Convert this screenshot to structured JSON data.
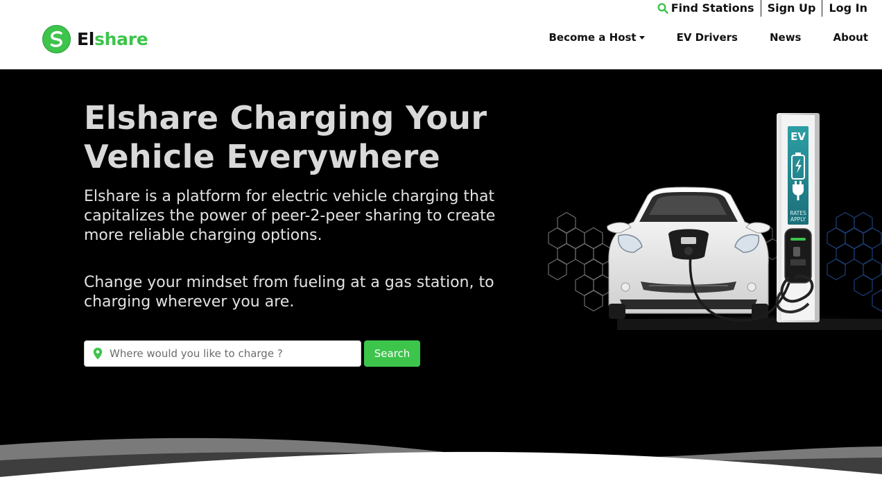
{
  "header": {
    "brand": {
      "part1": "El",
      "part2": "share"
    },
    "topbar": {
      "find_stations": "Find Stations",
      "sign_up": "Sign Up",
      "log_in": "Log In"
    },
    "nav": {
      "become_host": "Become a Host",
      "ev_drivers": "EV Drivers",
      "news": "News",
      "about": "About"
    }
  },
  "hero": {
    "title": "Elshare Charging Your Vehicle Everywhere",
    "description": "Elshare is a platform for electric vehicle charging that capitalizes the power of peer-2-peer sharing to create more reliable charging options.",
    "tagline": "Change your mindset from fueling at a gas station, to charging wherever you are.",
    "search": {
      "placeholder": "Where would you like to charge ?",
      "value": "",
      "button_label": "Search"
    },
    "station_sign": {
      "top": "EV",
      "bottom_line1": "RATES",
      "bottom_line2": "APPLY"
    }
  },
  "colors": {
    "brand_green": "#3dc44b",
    "hero_bg": "#000000",
    "header_bg": "#ffffff"
  },
  "icons": [
    "search-icon",
    "map-pin-icon",
    "caret-down-icon",
    "logo-icon"
  ]
}
